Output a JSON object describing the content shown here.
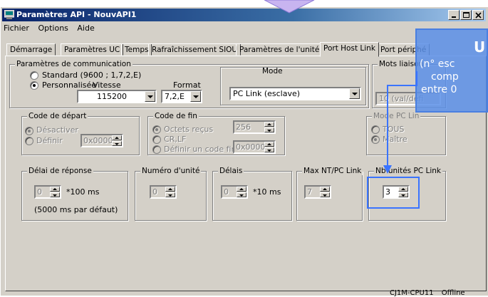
{
  "window": {
    "title": "Paramètres API - NouvAPI1"
  },
  "menu": [
    "Fichier",
    "Options",
    "Aide"
  ],
  "tabs": [
    "Démarrage",
    "Paramètres UC",
    "Temps",
    "Rafraîchissement SIOU",
    "Paramètres de l'unité",
    "Port Host Link",
    "Port périphé"
  ],
  "active_tab": "Port Host Link",
  "comm": {
    "legend": "Paramètres de communication",
    "standard_label": "Standard (9600 ; 1,7,2,E)",
    "custom_label": "Personnalisée",
    "speed_label": "Vitesse",
    "speed_value": "115200",
    "format_label": "Format",
    "format_value": "7,2,E",
    "mode_label": "Mode",
    "mode_value": "PC Link (esclave)"
  },
  "mots_liaison": {
    "legend": "Mots liaison",
    "value": "10 (val/défi"
  },
  "start_code": {
    "legend": "Code de départ",
    "disable_label": "Désactiver",
    "define_label": "Définir",
    "value": "0x0000"
  },
  "end_code": {
    "legend": "Code de fin",
    "received_label": "Octets reçus",
    "received_value": "256",
    "crlf_label": "CR,LF",
    "define_label": "Définir un code fin",
    "define_value": "0x0000"
  },
  "pc_link_mode": {
    "legend": "Mode PC Lin",
    "all_label": "TOUS",
    "master_label": "Maître"
  },
  "response_delay": {
    "legend": "Délai de réponse",
    "value": "0",
    "unit": "*100 ms",
    "note": "(5000 ms par défaut)"
  },
  "unit_number": {
    "legend": "Numéro d'unité",
    "value": "0"
  },
  "delays": {
    "legend": "Délais",
    "value": "0",
    "unit": "*10 ms"
  },
  "max_nt": {
    "legend": "Max NT/PC Link",
    "value": "7"
  },
  "pc_link_units": {
    "legend": "Nb unités PC Link",
    "value": "3"
  },
  "status": {
    "cpu": "CJ1M-CPU11",
    "state": "Offline"
  },
  "callout": {
    "heading": "U",
    "lines": [
      "(n° esc",
      "comp",
      "entre 0"
    ]
  },
  "colors": {
    "titlebar": "#0a246a",
    "callout": "#5b8fe8",
    "highlight": "#3a74ff",
    "face": "#d4d0c8"
  }
}
